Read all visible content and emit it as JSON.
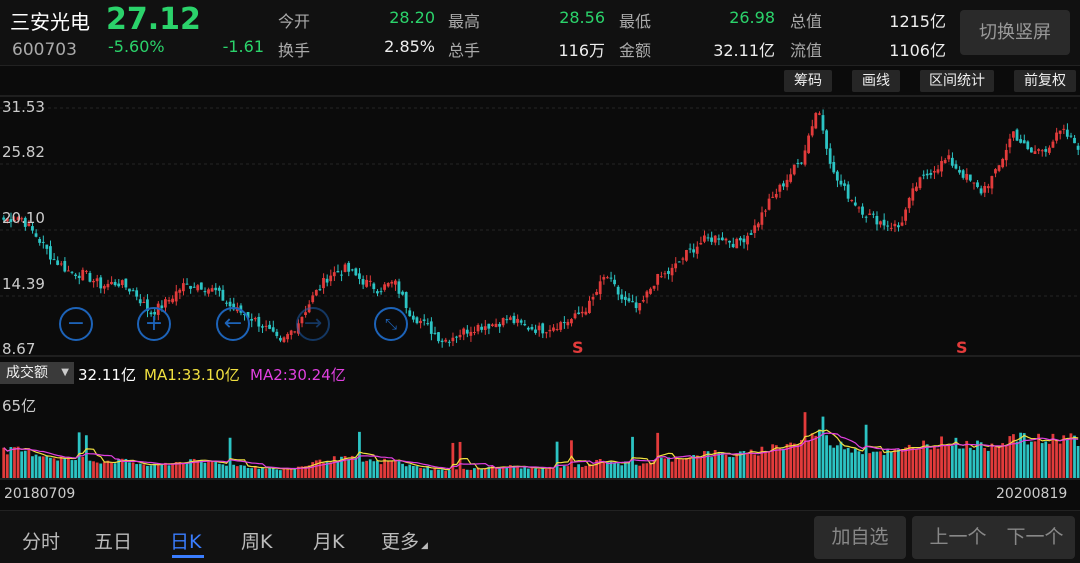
{
  "header": {
    "stock_name": "三安光电",
    "stock_code": "600703",
    "price": "27.12",
    "change_pct": "-5.60%",
    "change_abs": "-1.61",
    "quotes": [
      {
        "label": "今开",
        "value": "28.20"
      },
      {
        "label": "最高",
        "value": "28.56"
      },
      {
        "label": "最低",
        "value": "26.98"
      },
      {
        "label": "总值",
        "value": "1215亿"
      },
      {
        "label": "换手",
        "value": "2.85%"
      },
      {
        "label": "总手",
        "value": "116万"
      },
      {
        "label": "金额",
        "value": "32.11亿"
      },
      {
        "label": "流值",
        "value": "1106亿"
      }
    ],
    "switch_label": "切换竖屏"
  },
  "toolbar": {
    "chips_label": "筹码",
    "draw_label": "画线",
    "range_stats_label": "区间统计",
    "adjust_label": "前复权"
  },
  "chart": {
    "y_labels": [
      "31.53",
      "25.82",
      "20.10",
      "14.39",
      "8.67"
    ],
    "signal_label": "S",
    "controls": [
      "zoom-out",
      "zoom-in",
      "scroll-left",
      "scroll-right",
      "fullscreen"
    ]
  },
  "volume": {
    "selector_label": "成交额",
    "current": "32.11亿",
    "ma1": "MA1:33.10亿",
    "ma2": "MA2:30.24亿",
    "max_label": "65亿"
  },
  "dates": {
    "start": "20180709",
    "end": "20200819"
  },
  "tabs": [
    {
      "label": "分时"
    },
    {
      "label": "五日"
    },
    {
      "label": "日K"
    },
    {
      "label": "周K"
    },
    {
      "label": "月K"
    },
    {
      "label": "更多"
    }
  ],
  "nav": {
    "add_label": "加自选",
    "prev_label": "上一个",
    "next_label": "下一个"
  },
  "colors": {
    "up": "#e23b3b",
    "down": "#2cc4c4",
    "price_green": "#2bd36b",
    "ma1": "#f0e040",
    "ma2": "#e040e0",
    "accent": "#3a7dff"
  },
  "chart_data": {
    "type": "candlestick",
    "x_start": "20180709",
    "x_end": "20200819",
    "ylim": [
      8.67,
      31.53
    ],
    "y_ticks": [
      31.53,
      25.82,
      20.1,
      14.39,
      8.67
    ],
    "price_path": [
      20.5,
      20.8,
      19.0,
      17.0,
      15.8,
      15.5,
      14.5,
      14.8,
      14.0,
      12.0,
      13.0,
      14.5,
      14.6,
      14.0,
      12.5,
      11.8,
      10.8,
      9.2,
      11.0,
      13.5,
      15.5,
      16.0,
      15.0,
      14.2,
      14.8,
      12.0,
      10.8,
      9.5,
      10.2,
      10.8,
      11.0,
      11.5,
      10.8,
      10.5,
      11.0,
      11.5,
      12.8,
      15.5,
      13.2,
      12.3,
      15.0,
      15.8,
      17.5,
      18.6,
      19.0,
      18.3,
      19.5,
      22.0,
      24.0,
      26.0,
      30.8,
      24.5,
      22.5,
      21.0,
      20.2,
      19.8,
      23.5,
      25.0,
      26.0,
      24.5,
      23.0,
      24.8,
      28.5,
      26.5,
      27.0,
      28.5,
      27.2
    ],
    "volume_max_label": "65亿"
  }
}
